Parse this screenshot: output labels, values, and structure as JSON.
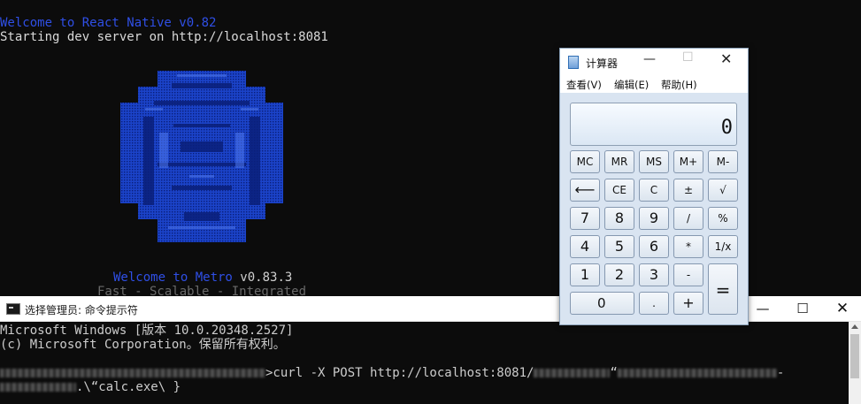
{
  "metro": {
    "rn_welcome": "Welcome to React Native v0.82",
    "dev_server": "Starting dev server on http://localhost:8081",
    "metro_welcome_a": "Welcome to Metro ",
    "metro_welcome_b": "v0.83.3",
    "tagline": "Fast - Scalable - Integrated",
    "logo_color": "#1e4fd8"
  },
  "cmd": {
    "title": "选择管理员: 命令提示符",
    "min": "—",
    "max": "☐",
    "close": "✕",
    "line1": "Microsoft Windows [版本 10.0.20348.2527]",
    "line2": "(c) Microsoft Corporation。保留所有权利。",
    "line3_prompt": ">curl -X POST http://localhost:8081/",
    "line3_q": "“",
    "line3_end": "-",
    "line4": ".\\“calc.exe\\ }"
  },
  "calc": {
    "title": "计算器",
    "min": "—",
    "max": "☐",
    "close": "✕",
    "menu": {
      "view": "查看(V)",
      "edit": "编辑(E)",
      "help": "帮助(H)"
    },
    "display": "0",
    "keys": {
      "mc": "MC",
      "mr": "MR",
      "ms": "MS",
      "mplus": "M+",
      "mminus": "M-",
      "back": "⟵",
      "ce": "CE",
      "c": "C",
      "pm": "±",
      "sqrt": "√",
      "7": "7",
      "8": "8",
      "9": "9",
      "div": "/",
      "pct": "%",
      "4": "4",
      "5": "5",
      "6": "6",
      "mul": "*",
      "inv": "1/x",
      "1": "1",
      "2": "2",
      "3": "3",
      "sub": "-",
      "eq": "=",
      "0": "0",
      "dot": ".",
      "add": "+"
    }
  }
}
